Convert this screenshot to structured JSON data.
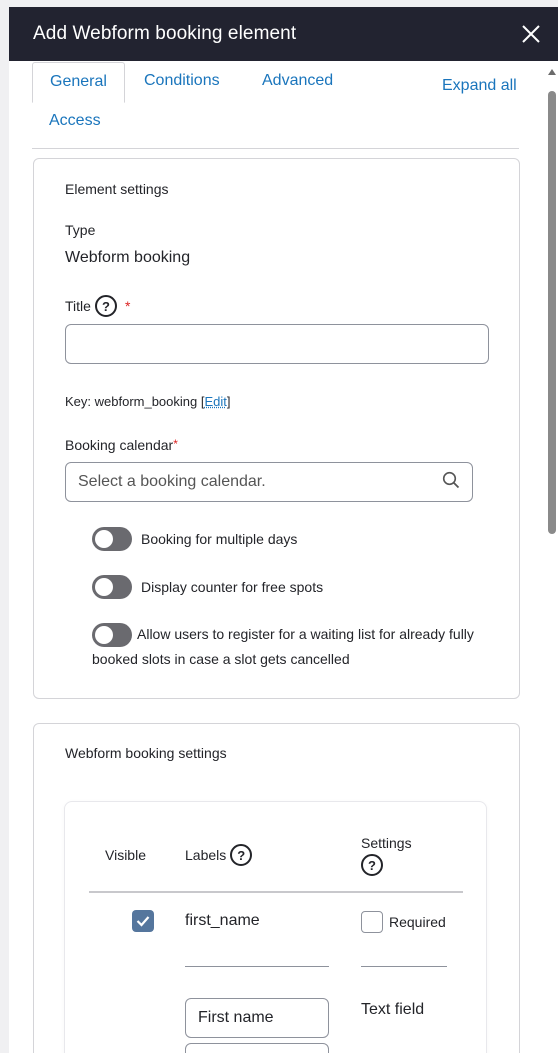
{
  "dialog": {
    "title": "Add Webform booking element",
    "close_icon": "close-icon"
  },
  "tabs": {
    "items": [
      "General",
      "Conditions",
      "Advanced",
      "Access"
    ],
    "active": "General",
    "expand_all": "Expand all"
  },
  "element_settings": {
    "heading": "Element settings",
    "type_label": "Type",
    "type_value": "Webform booking",
    "title_label": "Title",
    "title_help": "?",
    "required_marker": "*",
    "title_value": "",
    "key_prefix": "Key: webform_booking [",
    "key_edit": "Edit",
    "key_suffix": "]",
    "calendar_label": "Booking calendar",
    "calendar_placeholder": "Select a booking calendar.",
    "search_icon": "search-icon",
    "toggles": [
      {
        "label": "Booking for multiple days",
        "on": false
      },
      {
        "label": "Display counter for free spots",
        "on": false
      },
      {
        "label": "Allow users to register for a waiting list for already fully booked slots in case a slot gets cancelled",
        "on": false
      }
    ]
  },
  "booking_settings": {
    "heading": "Webform booking settings",
    "columns": {
      "visible": "Visible",
      "labels": "Labels",
      "settings": "Settings",
      "help": "?"
    },
    "rows": [
      {
        "visible": true,
        "name": "first_name",
        "required_label": "Required",
        "required": false,
        "label_value": "First name",
        "field_type": "Text field"
      }
    ]
  }
}
